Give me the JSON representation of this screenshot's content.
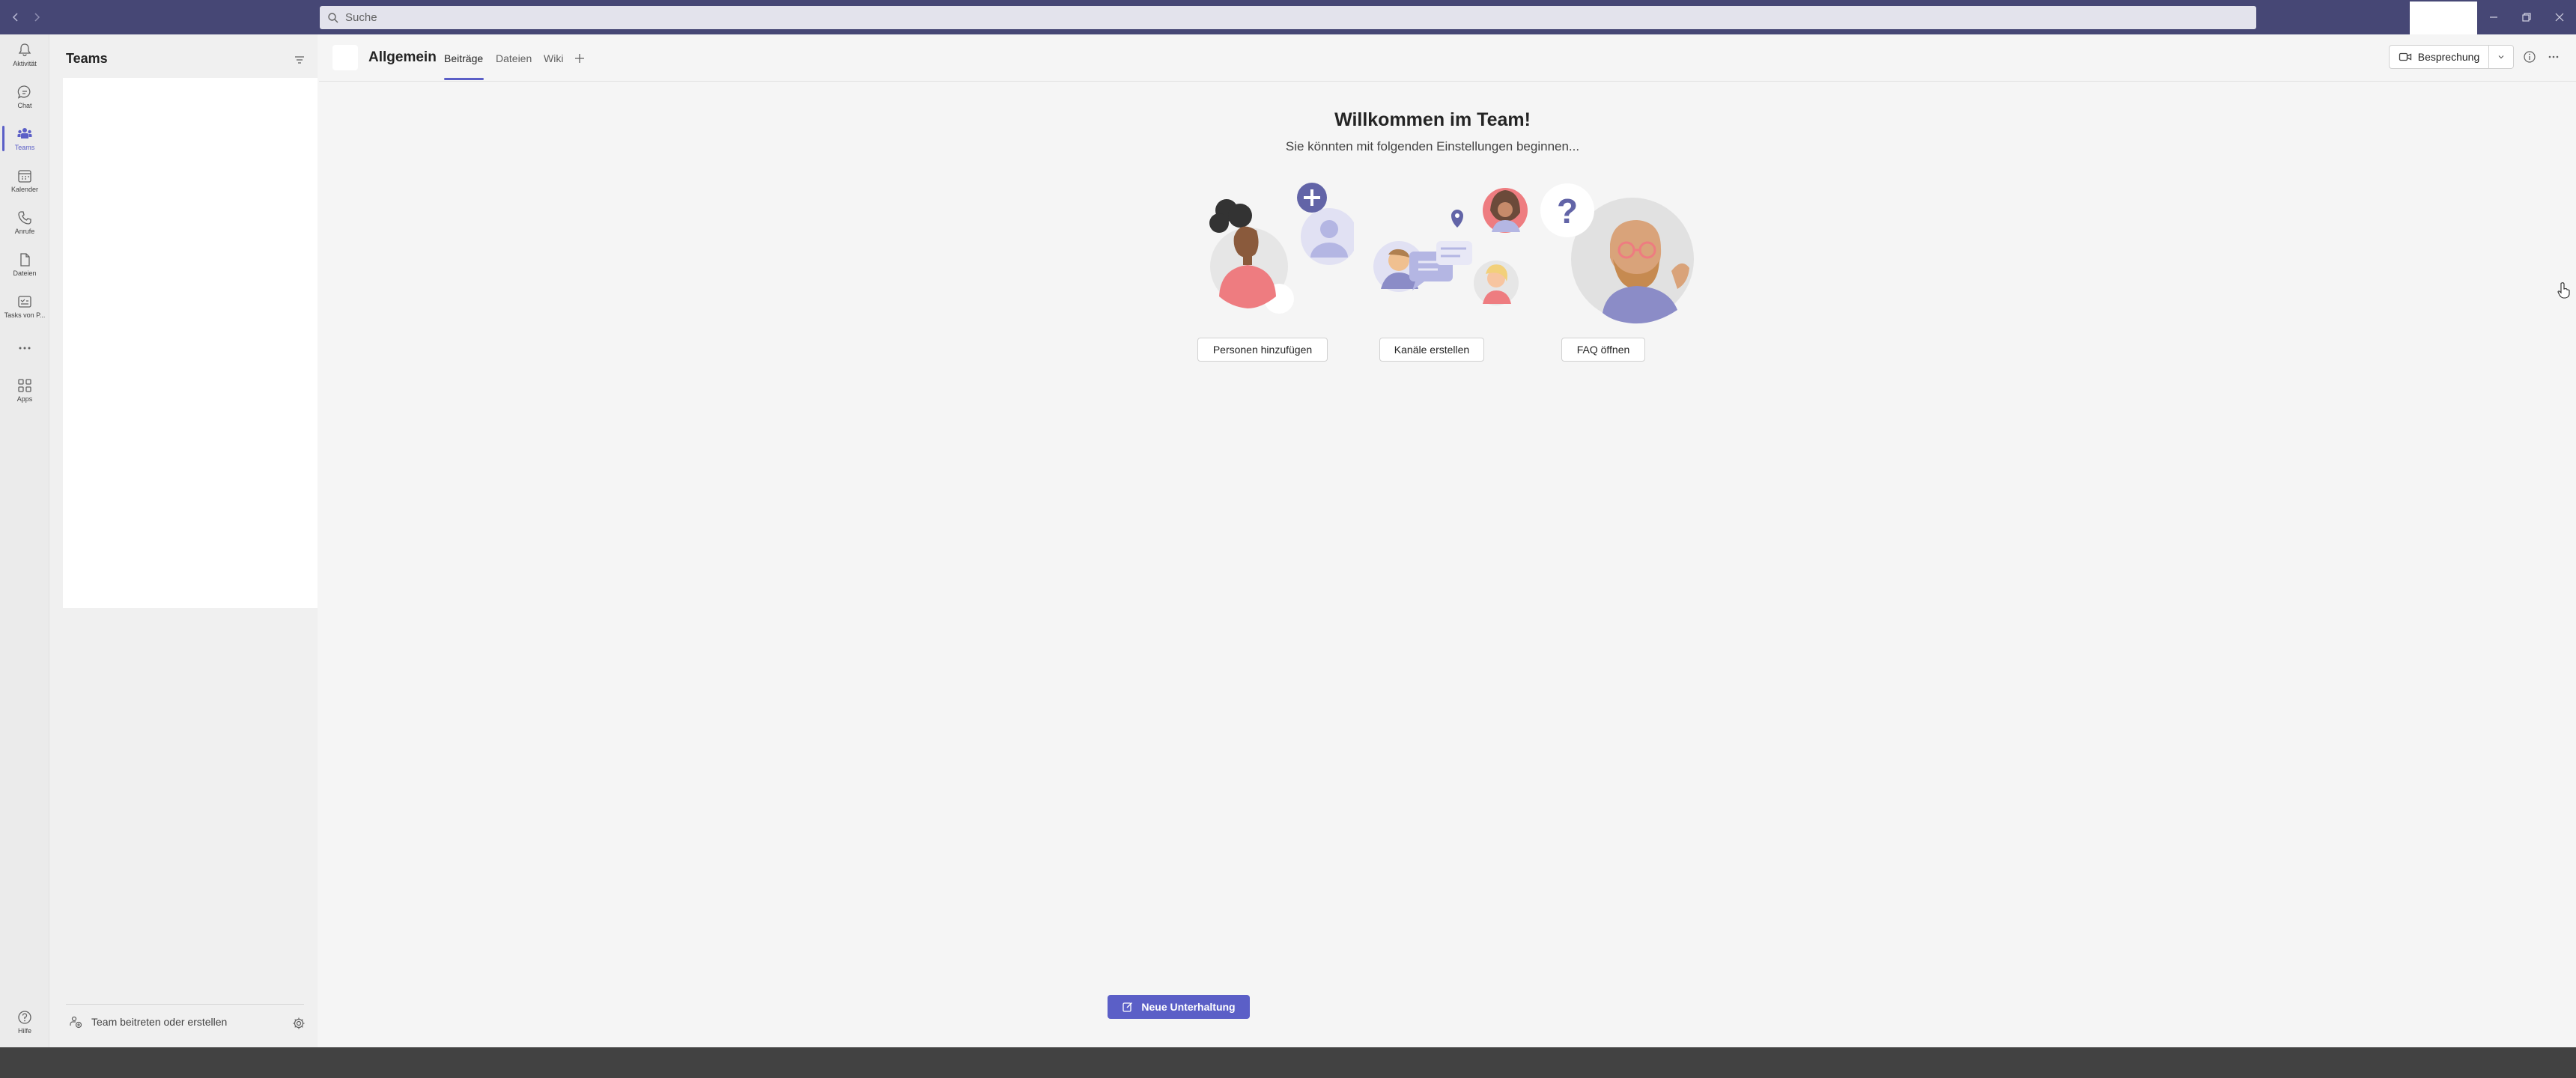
{
  "search": {
    "placeholder": "Suche"
  },
  "rail": {
    "items": [
      {
        "label": "Aktivität",
        "icon": "bell-icon"
      },
      {
        "label": "Chat",
        "icon": "chat-icon"
      },
      {
        "label": "Teams",
        "icon": "teams-icon",
        "active": true
      },
      {
        "label": "Kalender",
        "icon": "calendar-icon"
      },
      {
        "label": "Anrufe",
        "icon": "phone-icon"
      },
      {
        "label": "Dateien",
        "icon": "file-icon"
      },
      {
        "label": "Tasks von P...",
        "icon": "tasks-icon"
      },
      {
        "label": "",
        "icon": "more-icon"
      },
      {
        "label": "Apps",
        "icon": "apps-icon"
      }
    ],
    "help_label": "Hilfe"
  },
  "sidebar": {
    "title": "Teams",
    "join_label": "Team beitreten oder erstellen"
  },
  "channel": {
    "name": "Allgemein",
    "tabs": [
      "Beiträge",
      "Dateien",
      "Wiki"
    ],
    "active_tab": "Beiträge",
    "meeting_label": "Besprechung"
  },
  "welcome": {
    "title": "Willkommen im Team!",
    "subtitle": "Sie könnten mit folgenden Einstellungen beginnen...",
    "actions": [
      "Personen hinzufügen",
      "Kanäle erstellen",
      "FAQ öffnen"
    ]
  },
  "compose": {
    "new_conversation_label": "Neue Unterhaltung"
  },
  "colors": {
    "titlebar": "#464775",
    "accent": "#5b5fc7",
    "rail_bg": "#ebebeb",
    "taskbar": "#424242"
  }
}
